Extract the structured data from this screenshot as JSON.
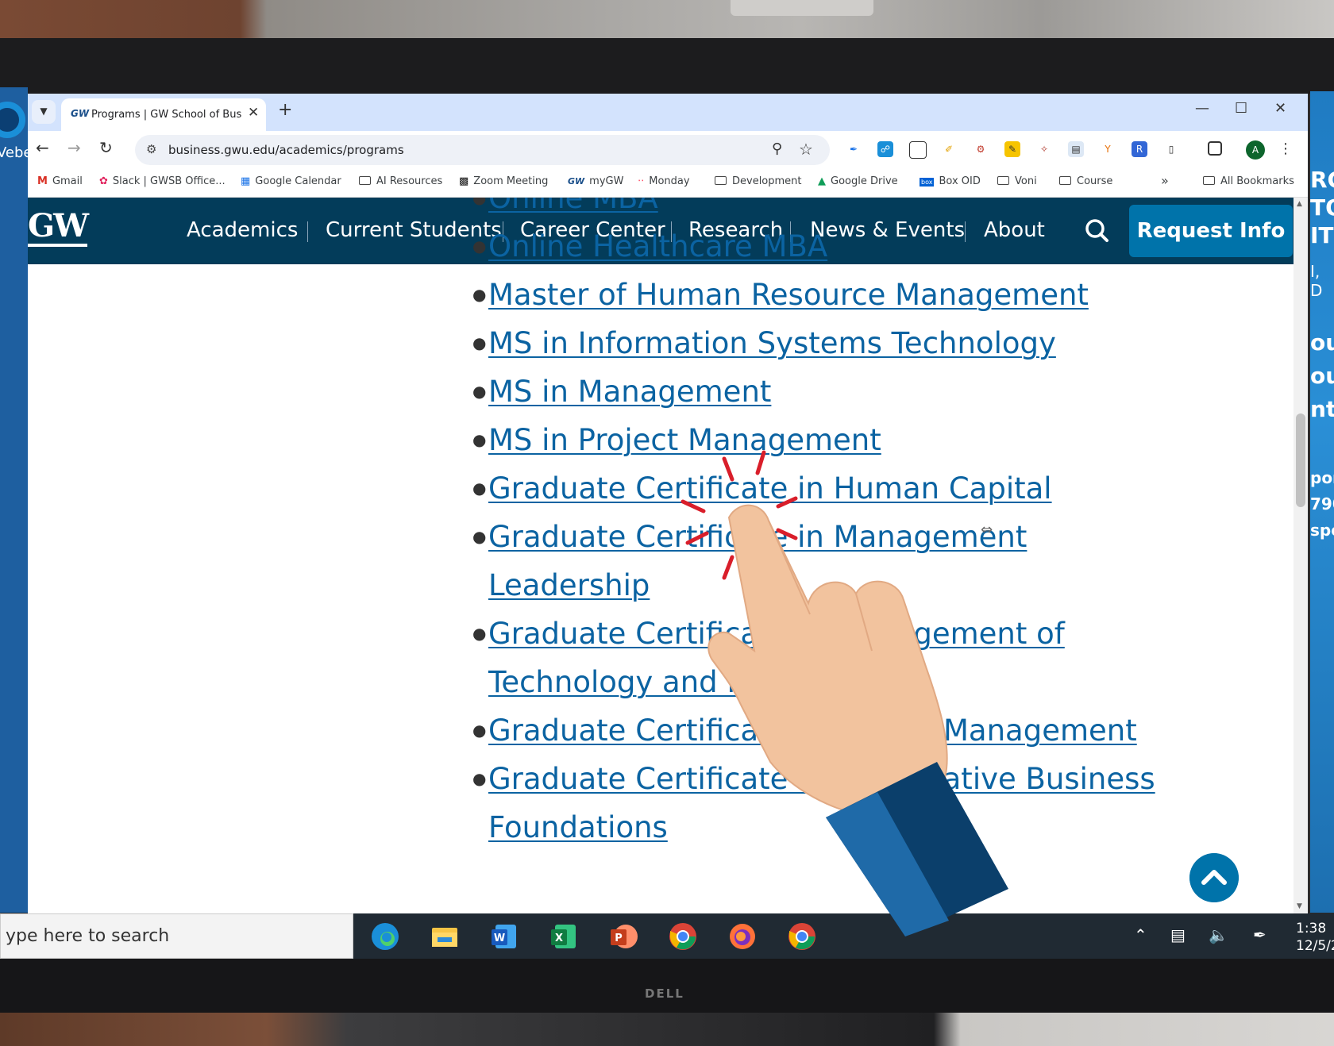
{
  "browser": {
    "tab_title": "Programs | GW School of Business",
    "tab_favicon": "GW",
    "url": "business.gwu.edu/academics/programs",
    "avatar_letter": "A"
  },
  "bookmarks": [
    {
      "label": "Gmail",
      "icon": "gmail-icon"
    },
    {
      "label": "Slack | GWSB Office...",
      "icon": "slack-icon"
    },
    {
      "label": "Google Calendar",
      "icon": "calendar-icon"
    },
    {
      "label": "AI Resources",
      "icon": "folder-icon"
    },
    {
      "label": "Zoom Meeting",
      "icon": "zoom-icon"
    },
    {
      "label": "myGW",
      "icon": "gw-icon"
    },
    {
      "label": "Monday",
      "icon": "monday-icon"
    },
    {
      "label": "Development",
      "icon": "folder-icon"
    },
    {
      "label": "Google Drive",
      "icon": "drive-icon"
    },
    {
      "label": "Box OID",
      "icon": "box-icon"
    },
    {
      "label": "Voni",
      "icon": "folder-icon"
    },
    {
      "label": "Course",
      "icon": "folder-icon"
    }
  ],
  "all_bookmarks": "All Bookmarks",
  "site": {
    "logo": "GW",
    "nav": [
      "Academics",
      "Current Students",
      "Career Center",
      "Research",
      "News & Events",
      "About"
    ],
    "request_button": "Request Info",
    "brand_color": "#033c5a",
    "accent_color": "#0073aa",
    "link_color": "#0b63a2"
  },
  "programs": [
    "Online MBA",
    "Online Healthcare MBA",
    "Master of Human Resource Management",
    "MS in Information Systems Technology",
    "MS in Management",
    "MS in Project Management",
    "Graduate Certificate in Human Capital",
    "Graduate Certificate in Management",
    "Leadership",
    "Graduate Certificate in Management of",
    "Technology and Innovation",
    "Graduate Certificate in Project Management",
    "Graduate Certificate in Quantitative Business",
    "Foundations"
  ],
  "taskbar": {
    "search_placeholder": "ype here to search",
    "time": "1:38",
    "date": "12/5/2"
  },
  "desktop": {
    "webex_label": "Vebe",
    "monitor_brand": "DELL",
    "right_window_fragments": [
      "RG",
      "TO",
      "IT",
      "I, D",
      "ou",
      "ou",
      "nt",
      "por",
      "790",
      "spo"
    ]
  }
}
